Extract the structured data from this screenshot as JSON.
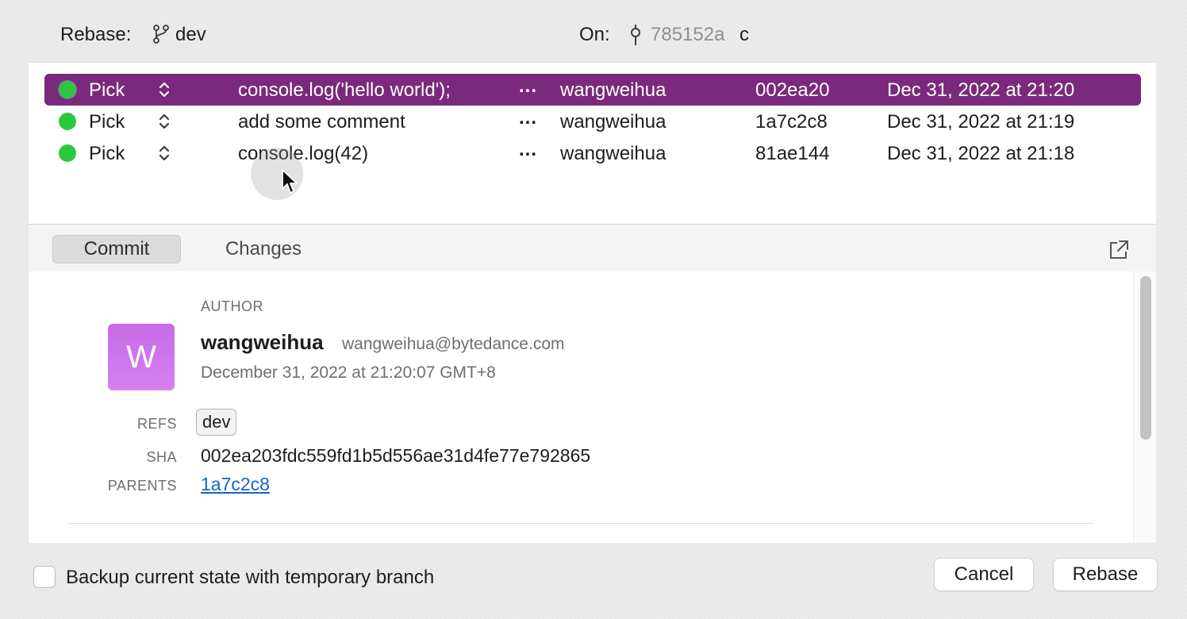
{
  "header": {
    "rebase_label": "Rebase:",
    "branch": "dev",
    "on_label": "On:",
    "onto_sha": "785152a",
    "onto_message": "c"
  },
  "commits": [
    {
      "action": "Pick",
      "message": "console.log('hello world');",
      "more": "...",
      "author": "wangweihua",
      "sha": "002ea20",
      "date": "Dec 31, 2022 at 21:20",
      "status_color": "#2ac840"
    },
    {
      "action": "Pick",
      "message": "add some comment",
      "more": "...",
      "author": "wangweihua",
      "sha": "1a7c2c8",
      "date": "Dec 31, 2022 at 21:19",
      "status_color": "#2ac840"
    },
    {
      "action": "Pick",
      "message": "console.log(42)",
      "more": "...",
      "author": "wangweihua",
      "sha": "81ae144",
      "date": "Dec 31, 2022 at 21:18",
      "status_color": "#2ac840"
    }
  ],
  "tabs": {
    "commit": "Commit",
    "changes": "Changes"
  },
  "detail": {
    "author_label": "AUTHOR",
    "avatar_letter": "W",
    "author_name": "wangweihua",
    "author_email": "wangweihua@bytedance.com",
    "date": "December 31, 2022 at 21:20:07 GMT+8",
    "refs_label": "REFS",
    "ref": "dev",
    "sha_label": "SHA",
    "sha": "002ea203fdc559fd1b5d556ae31d4fe77e792865",
    "parents_label": "PARENTS",
    "parent": "1a7c2c8"
  },
  "footer": {
    "backup_label": "Backup current state with temporary branch",
    "cancel": "Cancel",
    "rebase": "Rebase"
  },
  "colors": {
    "selected_row": "#7a2a7c",
    "status_dot": "#2ac840",
    "avatar": "#c76ae6",
    "link": "#1565c0"
  }
}
